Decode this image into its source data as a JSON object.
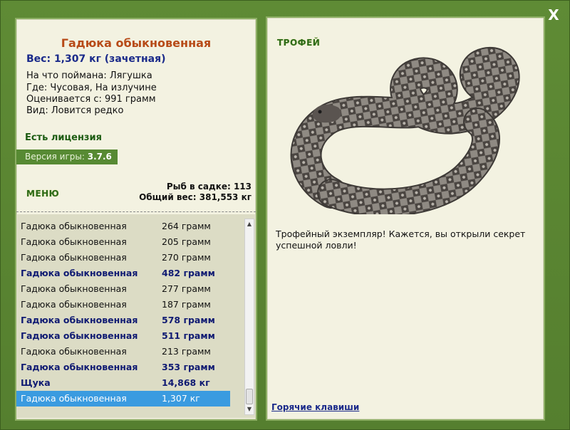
{
  "window": {
    "close_label": "X"
  },
  "fish": {
    "title": "Гадюка обыкновенная",
    "weight": "Вес: 1,307 кг (зачетная)",
    "caught_on": "На что поймана: Лягушка",
    "where": "Где: Чусовая, На излучине",
    "valued_from": "Оценивается с: 991 грамм",
    "rarity": "Вид: Ловится редко"
  },
  "license": "Есть лицензия",
  "version": {
    "label": "Версия игры:",
    "value": "3.7.6"
  },
  "menu_label": "МЕНЮ",
  "stats": {
    "fish_in_keepnet": "Рыб в садке: 113",
    "total_weight": "Общий вес: 381,553 кг"
  },
  "catch_list": [
    {
      "name": "Гадюка обыкновенная",
      "weight": "264 грамм",
      "bold": false,
      "selected": false
    },
    {
      "name": "Гадюка обыкновенная",
      "weight": "205 грамм",
      "bold": false,
      "selected": false
    },
    {
      "name": "Гадюка обыкновенная",
      "weight": "270 грамм",
      "bold": false,
      "selected": false
    },
    {
      "name": "Гадюка обыкновенная",
      "weight": "482 грамм",
      "bold": true,
      "selected": false
    },
    {
      "name": "Гадюка обыкновенная",
      "weight": "277 грамм",
      "bold": false,
      "selected": false
    },
    {
      "name": "Гадюка обыкновенная",
      "weight": "187 грамм",
      "bold": false,
      "selected": false
    },
    {
      "name": "Гадюка обыкновенная",
      "weight": "578 грамм",
      "bold": true,
      "selected": false
    },
    {
      "name": "Гадюка обыкновенная",
      "weight": "511 грамм",
      "bold": true,
      "selected": false
    },
    {
      "name": "Гадюка обыкновенная",
      "weight": "213 грамм",
      "bold": false,
      "selected": false
    },
    {
      "name": "Гадюка обыкновенная",
      "weight": "353 грамм",
      "bold": true,
      "selected": false
    },
    {
      "name": "Щука",
      "weight": "14,868 кг",
      "bold": true,
      "selected": false
    },
    {
      "name": "Гадюка обыкновенная",
      "weight": "1,307 кг",
      "bold": false,
      "selected": true
    }
  ],
  "trophy": {
    "label": "ТРОФЕЙ",
    "image_icon": "viper-snake-image",
    "message": "Трофейный экземпляр! Кажется, вы открыли секрет успешной ловли!"
  },
  "hotkeys_label": "Горячие клавиши",
  "colors": {
    "frame_green": "#5f8b35",
    "panel_bg": "#f3f2e1",
    "title_orange": "#b74a17",
    "weight_blue": "#1a2a8a",
    "selection_blue": "#3a9be0"
  }
}
